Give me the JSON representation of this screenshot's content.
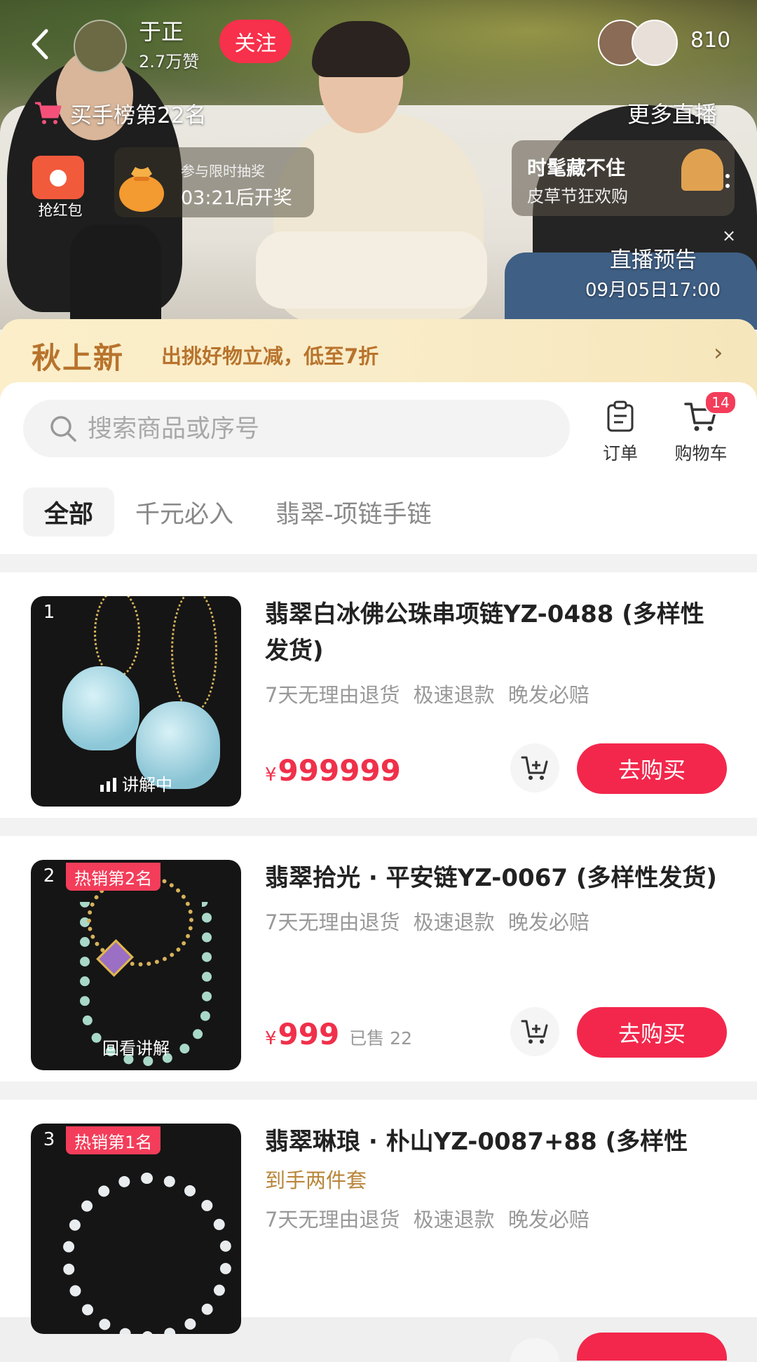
{
  "header": {
    "anchor_name": "于正",
    "anchor_likes": "2.7万赞",
    "follow_label": "关注",
    "viewer_count": "810",
    "rank_text": "买手榜第22名",
    "more_live_label": "更多直播",
    "redpack_label": "抢红包",
    "lottery": {
      "line1": "参与限时抽奖",
      "line2": "03:21后开奖"
    },
    "promo_card": {
      "title": "时髦藏不住",
      "subtitle": "皮草节狂欢购"
    },
    "preview": {
      "title": "直播预告",
      "time": "09月05日17:00"
    },
    "close_icon": "×"
  },
  "banner": {
    "title": "秋上新",
    "subtitle": "出挑好物立减，低至7折",
    "chevron": "›"
  },
  "shop": {
    "search_placeholder": "搜索商品或序号",
    "orders_label": "订单",
    "cart_label": "购物车",
    "cart_badge": "14",
    "tabs": [
      {
        "label": "全部",
        "active": true
      },
      {
        "label": "千元必入",
        "active": false
      },
      {
        "label": "翡翠-项链手链",
        "active": false
      }
    ],
    "products": [
      {
        "index": "1",
        "name": "翡翠白冰佛公珠串项链YZ-0488 (多样性发货)",
        "services": "7天无理由退货 极速退款 晚发必赔",
        "price": "999999",
        "currency": "¥",
        "thumb_tag": "讲解中",
        "buy_label": "去购买"
      },
      {
        "index": "2",
        "hot_badge": "热销第2名",
        "name": "翡翠拾光 · 平安链YZ-0067 (多样性发货)",
        "services": "7天无理由退货 极速退款 晚发必赔",
        "price": "999",
        "currency": "¥",
        "sold": "已售 22",
        "thumb_tag": "回看讲解",
        "buy_label": "去购买"
      },
      {
        "index": "3",
        "hot_badge": "热销第1名",
        "name": "翡翠琳琅 · 朴山YZ-0087+88 (多样性",
        "gold_text": "到手两件套",
        "services": "7天无理由退货 极速退款 晚发必赔"
      }
    ]
  },
  "colors": {
    "accent_red": "#f3274c",
    "price_red": "#f0304a",
    "banner_gold": "#b8732d"
  },
  "icons": [
    "back-arrow-icon",
    "shopping-cart-icon",
    "search-icon",
    "order-clipboard-icon",
    "cart-icon",
    "add-to-cart-icon",
    "signal-bars-icon"
  ]
}
